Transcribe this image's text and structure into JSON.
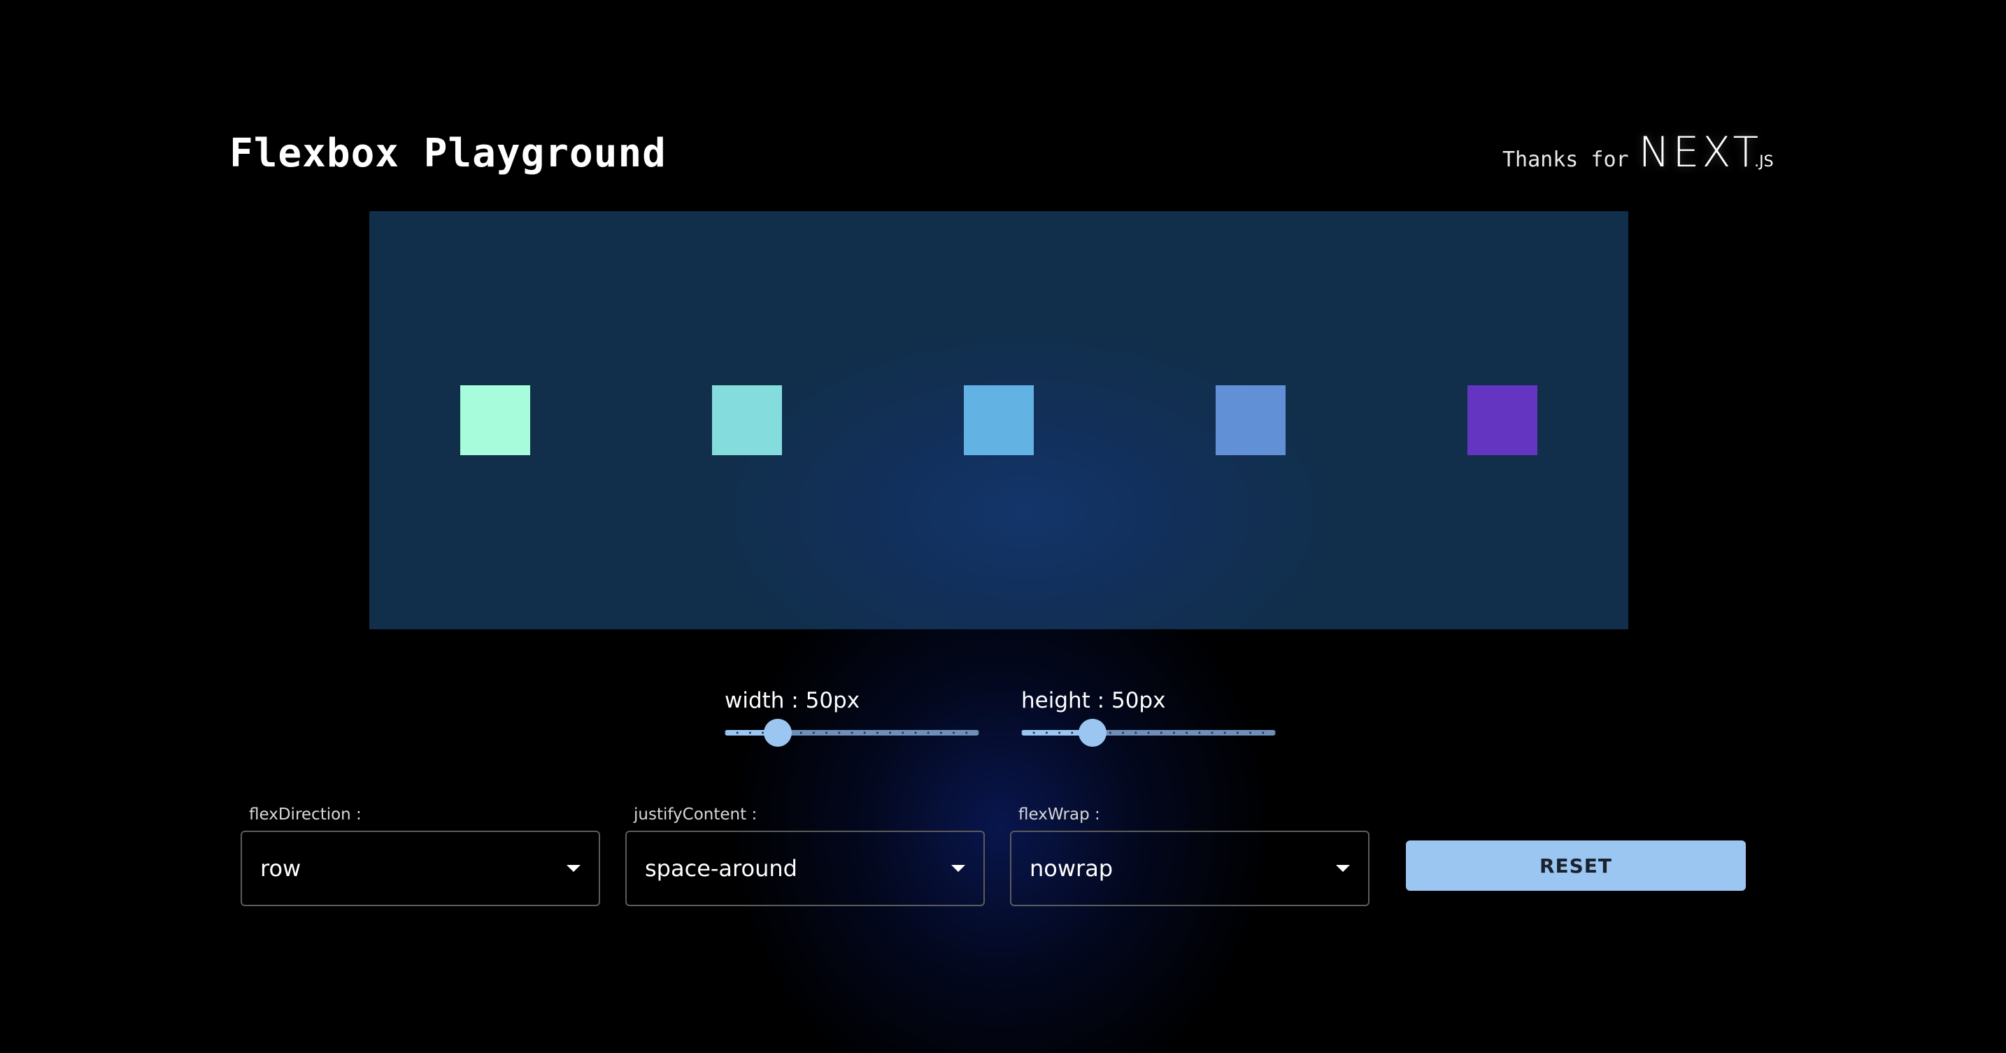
{
  "header": {
    "title": "Flexbox Playground",
    "thanks_text": "Thanks for",
    "brand_main": "NEXT",
    "brand_suffix": ".JS"
  },
  "container": {
    "background": "#112f4b",
    "flex_direction": "row",
    "justify_content": "space-around",
    "flex_wrap": "nowrap",
    "boxes": [
      {
        "color": "#a6fcdb"
      },
      {
        "color": "#85dcdd"
      },
      {
        "color": "#62b2e3"
      },
      {
        "color": "#6290d7"
      },
      {
        "color": "#6435c0"
      }
    ]
  },
  "sliders": {
    "width": {
      "label": "width : 50px",
      "value": 50
    },
    "height": {
      "label": "height : 50px",
      "value": 50
    }
  },
  "selects": {
    "flex_direction": {
      "label": "flexDirection :",
      "value": "row"
    },
    "justify_content": {
      "label": "justifyContent :",
      "value": "space-around"
    },
    "flex_wrap": {
      "label": "flexWrap :",
      "value": "nowrap"
    }
  },
  "reset": {
    "label": "RESET"
  },
  "colors": {
    "accent": "#9cc6f2",
    "background": "#000000"
  }
}
